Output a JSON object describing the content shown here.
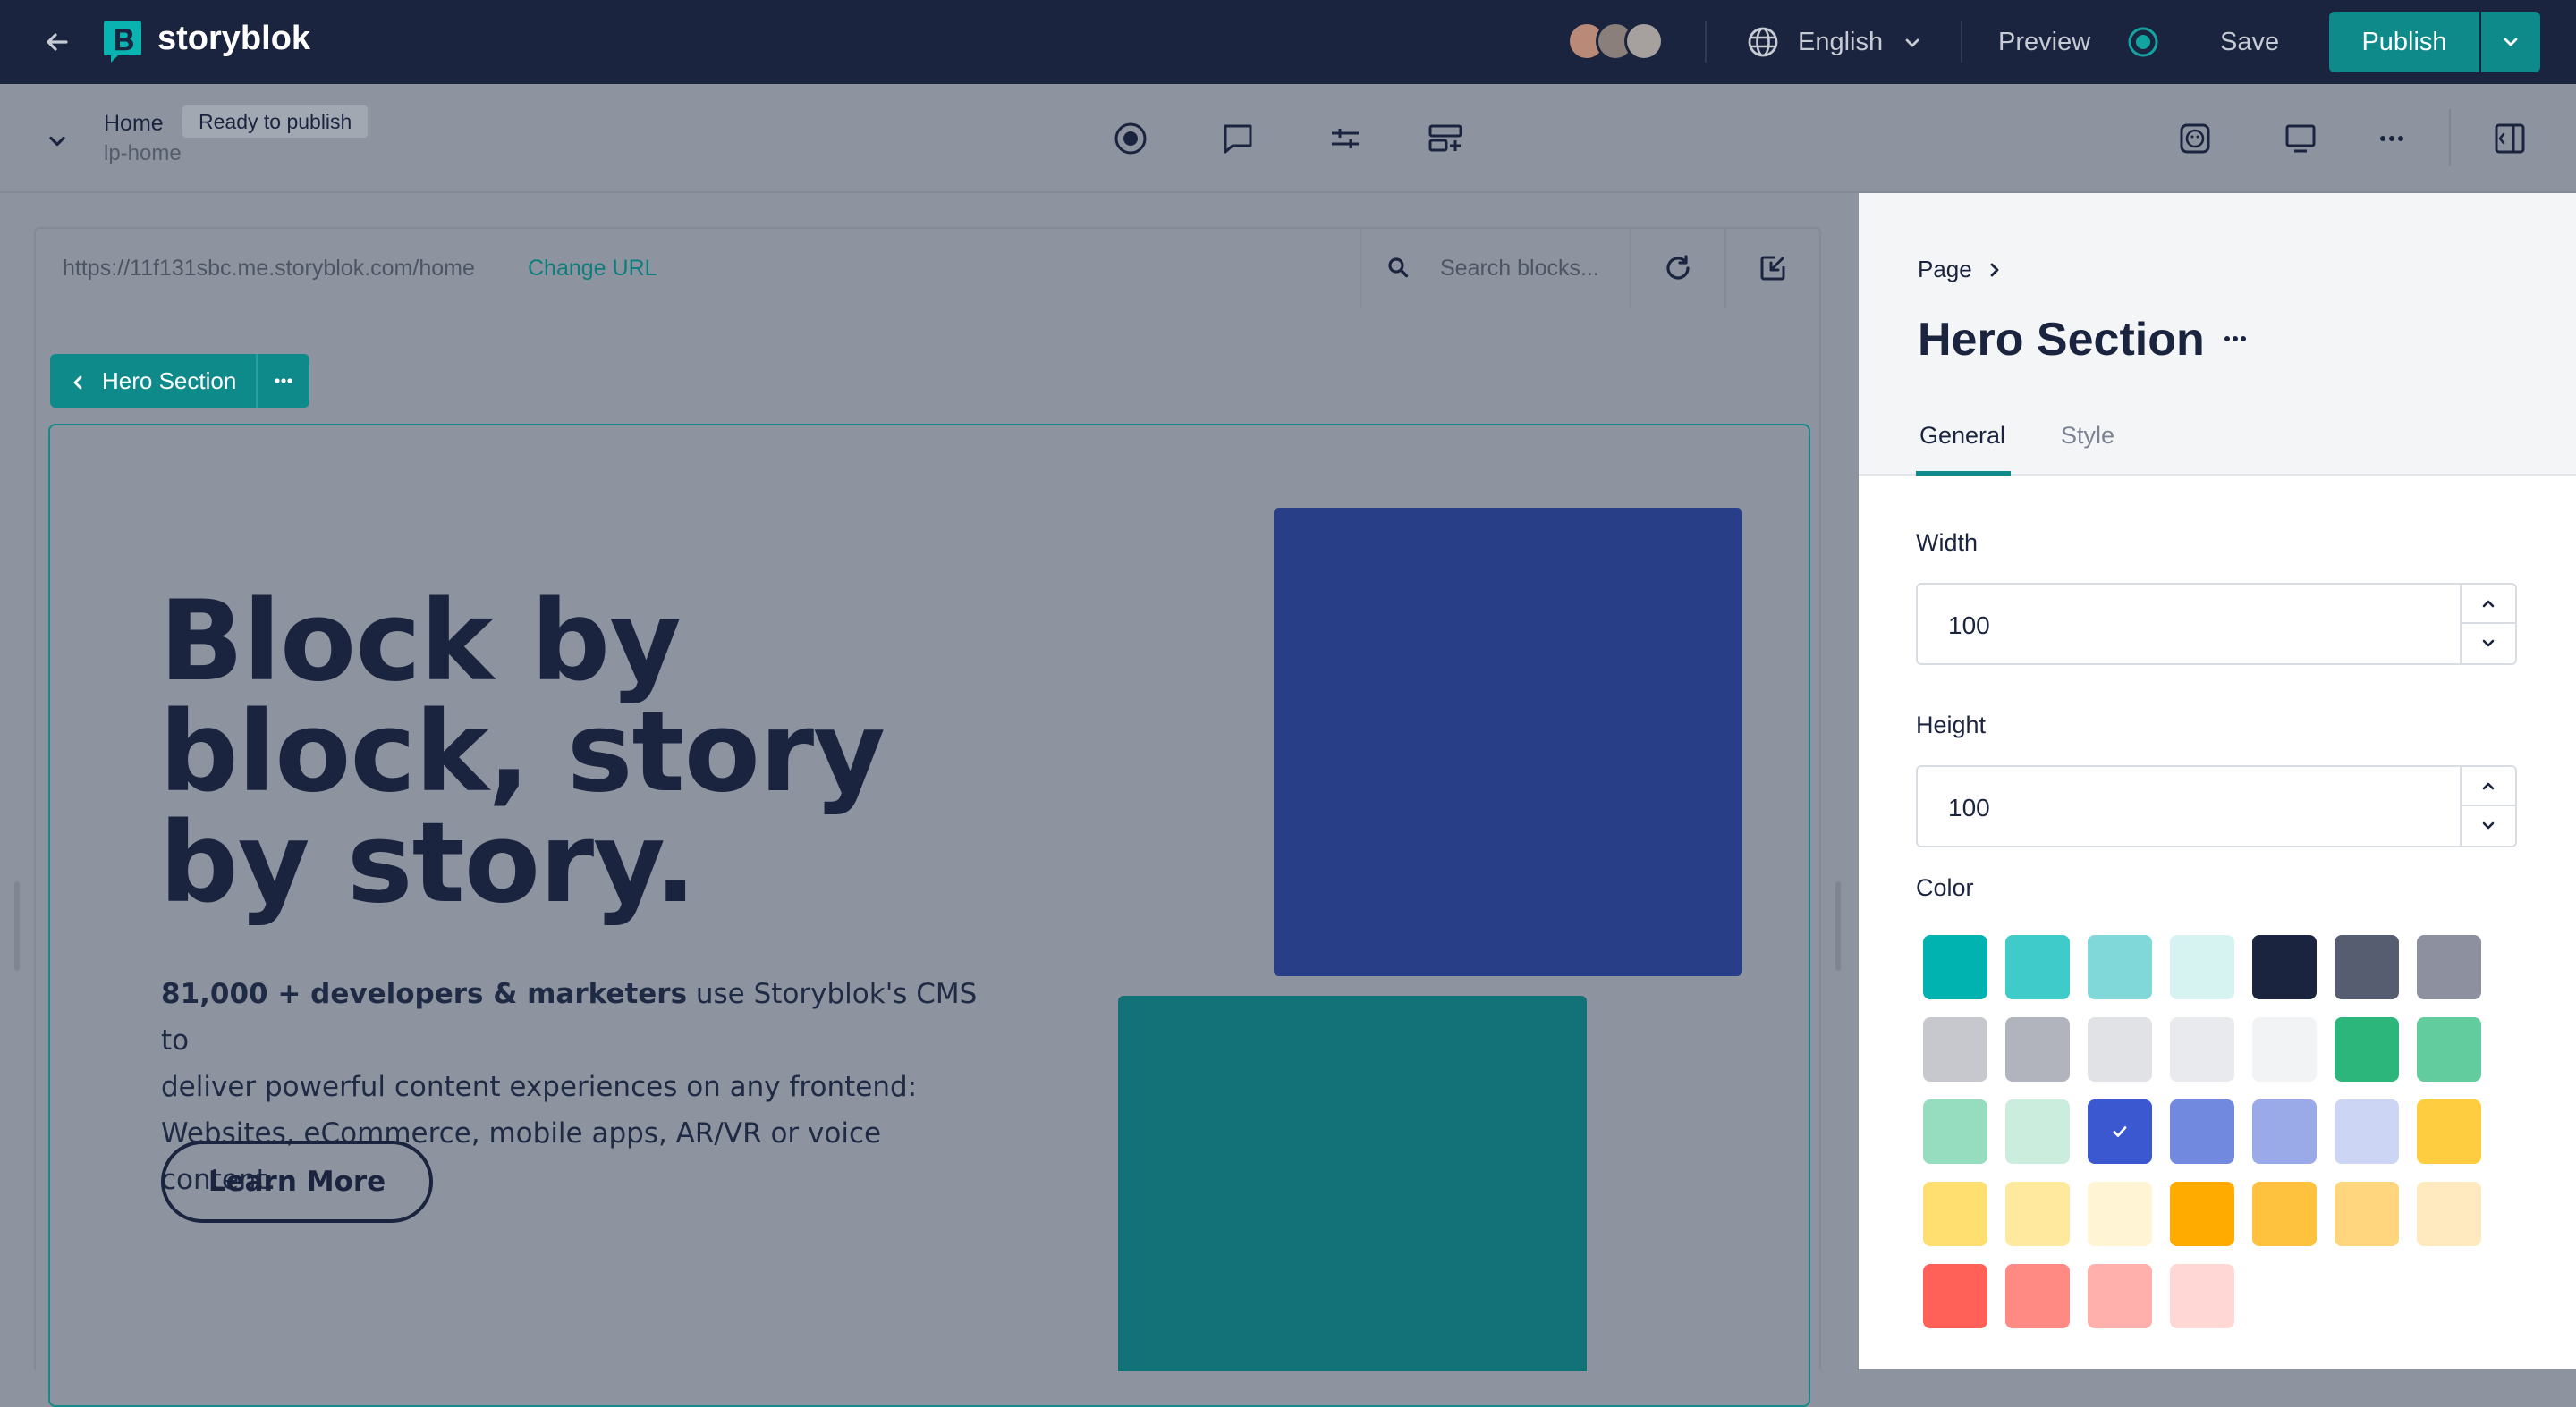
{
  "topbar": {
    "brand": "storyblok",
    "language": "English",
    "preview_label": "Preview",
    "save_label": "Save",
    "publish_label": "Publish"
  },
  "toolbar": {
    "story_name": "Home",
    "status_badge": "Ready to publish",
    "slug": "lp-home"
  },
  "preview": {
    "url": "https://11f131sbc.me.storyblok.com/home",
    "change_url_label": "Change URL",
    "search_placeholder": "Search blocks...",
    "block_chip_label": "Hero Section",
    "hero": {
      "heading_line1": "Block by",
      "heading_line2": "block, story",
      "heading_line3": "by story.",
      "para_bold": "81,000 + developers & marketers",
      "para_rest1": " use Storyblok's CMS to",
      "para_line2": "deliver powerful content experiences on any frontend:",
      "para_line3": "Websites, eCommerce, mobile apps, AR/VR or voice content.",
      "button_label": "Learn More"
    }
  },
  "panel": {
    "breadcrumb": "Page",
    "title": "Hero Section",
    "tabs": [
      {
        "label": "General",
        "active": true
      },
      {
        "label": "Style",
        "active": false
      }
    ],
    "width_label": "Width",
    "width_value": "100",
    "height_label": "Height",
    "height_value": "100",
    "color_label": "Color",
    "colors": [
      "#00b3b0",
      "#3fcbc9",
      "#80d9d8",
      "#d6f3f2",
      "#1b243f",
      "#575d71",
      "#8d919f",
      "#c6c8ce",
      "#b1b4bc",
      "#e0e2e6",
      "#e9eaed",
      "#f2f3f5",
      "#2db67c",
      "#62cc9f",
      "#96dcbe",
      "#caedde",
      "#3b58d0",
      "#7189df",
      "#9aaae8",
      "#ccd5f3",
      "#ffcd3f",
      "#ffdf6f",
      "#ffe99f",
      "#fff4d3",
      "#ffab00",
      "#ffc23f",
      "#ffd57e",
      "#ffeabf",
      "#ff6159",
      "#ff8983",
      "#ffb0ac",
      "#ffd8d5"
    ],
    "selected_color": "#3b58d0"
  }
}
